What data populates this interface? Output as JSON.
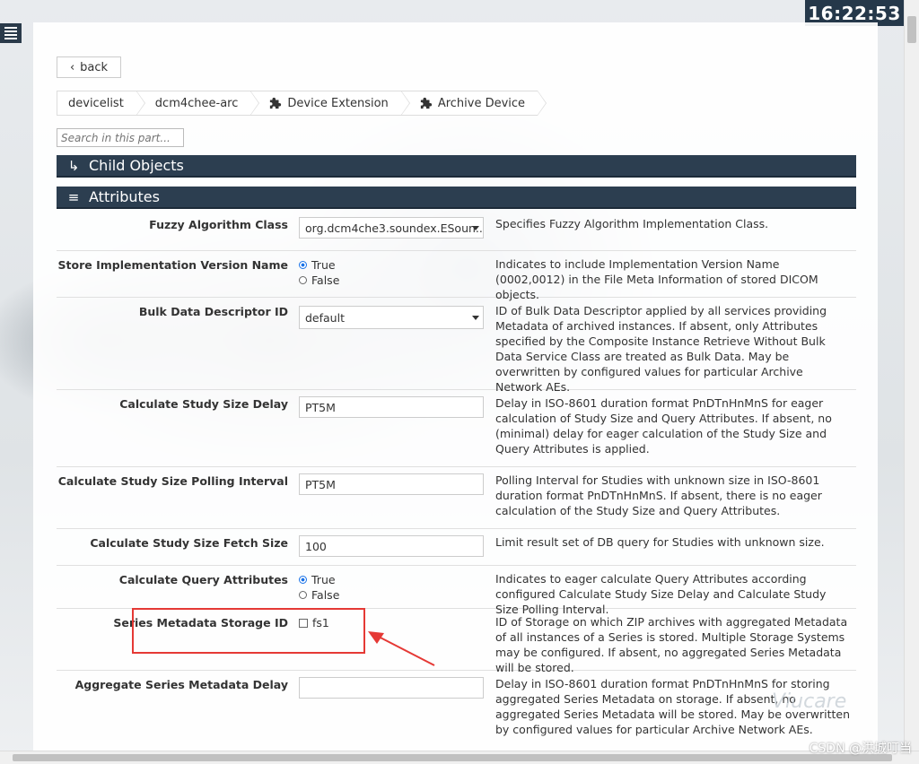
{
  "clock": "16:22:53",
  "nav": {
    "back_label": "back",
    "breadcrumbs": [
      "devicelist",
      "dcm4chee-arc",
      "Device Extension",
      "Archive Device"
    ]
  },
  "search": {
    "placeholder": "Search in this part..."
  },
  "sections": {
    "child_objects": "Child Objects",
    "attributes": "Attributes"
  },
  "rows": [
    {
      "label": "Fuzzy Algorithm Class",
      "value": "org.dcm4che3.soundex.ESoun...",
      "desc": "Specifies Fuzzy Algorithm Implementation Class."
    },
    {
      "label": "Store Implementation Version Name",
      "options": [
        "True",
        "False"
      ],
      "selected": "True",
      "desc": "Indicates to include Implementation Version Name (0002,0012) in the File Meta Information of stored DICOM objects."
    },
    {
      "label": "Bulk Data Descriptor ID",
      "value": "default",
      "desc": "ID of Bulk Data Descriptor applied by all services providing Metadata of archived instances. If absent, only Attributes specified by the Composite Instance Retrieve Without Bulk Data Service Class are treated as Bulk Data. May be overwritten by configured values for particular Archive Network AEs."
    },
    {
      "label": "Calculate Study Size Delay",
      "value": "PT5M",
      "desc": "Delay in ISO-8601 duration format PnDTnHnMnS for eager calculation of Study Size and Query Attributes. If absent, no (minimal) delay for eager calculation of the Study Size and Query Attributes is applied."
    },
    {
      "label": "Calculate Study Size Polling Interval",
      "value": "PT5M",
      "desc": "Polling Interval for Studies with unknown size in ISO-8601 duration format PnDTnHnMnS. If absent, there is no eager calculation of the Study Size and Query Attributes."
    },
    {
      "label": "Calculate Study Size Fetch Size",
      "value": "100",
      "desc": "Limit result set of DB query for Studies with unknown size."
    },
    {
      "label": "Calculate Query Attributes",
      "options": [
        "True",
        "False"
      ],
      "selected": "True",
      "desc": "Indicates to eager calculate Query Attributes according configured Calculate Study Size Delay and Calculate Study Size Polling Interval."
    },
    {
      "label": "Series Metadata Storage ID",
      "checkbox": "fs1",
      "desc": "ID of Storage on which ZIP archives with aggregated Metadata of all instances of a Series is stored. Multiple Storage Systems may be configured. If absent, no aggregated Series Metadata will be stored."
    },
    {
      "label": "Aggregate Series Metadata Delay",
      "value": "",
      "desc": "Delay in ISO-8601 duration format PnDTnHnMnS for storing aggregated Series Metadata on storage. If absent, no aggregated Series Metadata will be stored. May be overwritten by configured values for particular Archive Network AEs."
    }
  ],
  "watermark": "CSDN @洪城叮当",
  "background_logo": "Viucare",
  "colors": {
    "header_bar": "#2c3e50",
    "clock_bg": "#25384a",
    "highlight": "#e53935"
  }
}
